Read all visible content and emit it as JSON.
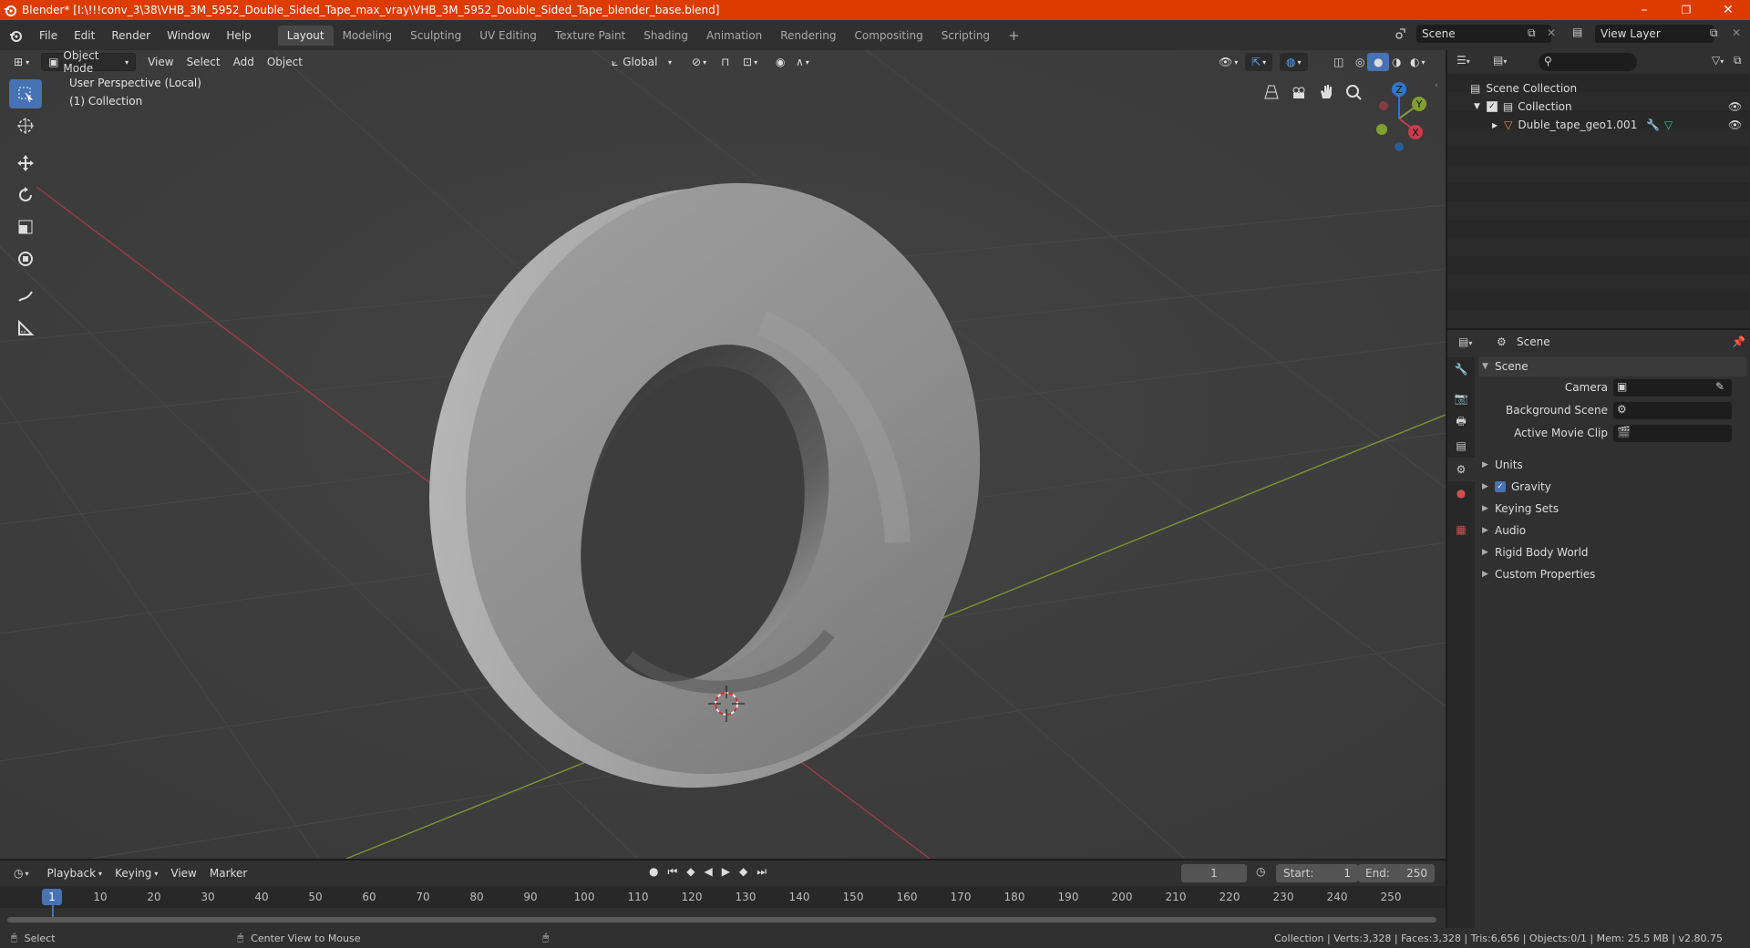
{
  "window": {
    "title": "Blender* [I:\\!!!conv_3\\38\\VHB_3M_5952_Double_Sided_Tape_max_vray\\VHB_3M_5952_Double_Sided_Tape_blender_base.blend]",
    "minimize": "–",
    "maximize": "❐",
    "close": "✕"
  },
  "menubar": {
    "items": [
      "File",
      "Edit",
      "Render",
      "Window",
      "Help"
    ],
    "workspaces": [
      "Layout",
      "Modeling",
      "Sculpting",
      "UV Editing",
      "Texture Paint",
      "Shading",
      "Animation",
      "Rendering",
      "Compositing",
      "Scripting"
    ],
    "active_workspace": "Layout",
    "add_tab": "+",
    "scene_name": "Scene",
    "view_layer_name": "View Layer"
  },
  "viewport": {
    "mode": "Object Mode",
    "menus": [
      "View",
      "Select",
      "Add",
      "Object"
    ],
    "transform_orientation": "Global",
    "perspective_label": "User Perspective (Local)",
    "collection_label": "(1) Collection",
    "gizmo_axes": {
      "x": "X",
      "y": "Y",
      "z": "Z"
    },
    "colors": {
      "x_axis": "#a03c47",
      "y_axis": "#7a9630",
      "background": "#3d3d3d"
    }
  },
  "outliner": {
    "root": "Scene Collection",
    "collection": "Collection",
    "object": "Duble_tape_geo1.001"
  },
  "properties": {
    "header": "Scene",
    "panel_title": "Scene",
    "camera_label": "Camera",
    "background_scene_label": "Background Scene",
    "active_movie_clip_label": "Active Movie Clip",
    "subpanels": [
      "Units",
      "Gravity",
      "Keying Sets",
      "Audio",
      "Rigid Body World",
      "Custom Properties"
    ],
    "gravity_checked": true
  },
  "timeline": {
    "menus": [
      "Playback",
      "Keying",
      "View",
      "Marker"
    ],
    "current_frame": "1",
    "start_label": "Start:",
    "start_value": "1",
    "end_label": "End:",
    "end_value": "250",
    "ruler_current": "1",
    "ticks": [
      "10",
      "20",
      "30",
      "40",
      "50",
      "60",
      "70",
      "80",
      "90",
      "100",
      "110",
      "120",
      "130",
      "140",
      "150",
      "160",
      "170",
      "180",
      "190",
      "200",
      "210",
      "220",
      "230",
      "240",
      "250"
    ]
  },
  "statusbar": {
    "left_action": "Select",
    "middle_action": "Center View to Mouse",
    "stats": "Collection | Verts:3,328 | Faces:3,328 | Tris:6,656 | Objects:0/1 | Mem: 25.5 MB | v2.80.75"
  }
}
